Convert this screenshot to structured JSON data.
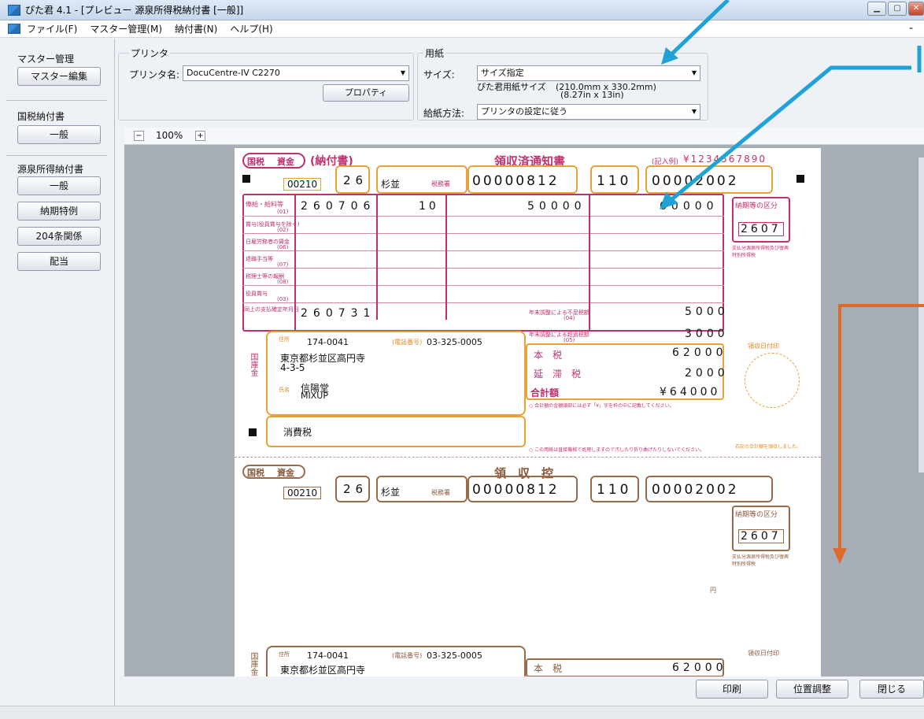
{
  "window": {
    "title": "ぴた君 4.1 - [プレビュー 源泉所得税納付書 [一般]]"
  },
  "menu": {
    "items": [
      "ファイル(F)",
      "マスター管理(M)",
      "納付書(N)",
      "ヘルプ(H)"
    ],
    "right": "-"
  },
  "sidebar": {
    "master_title": "マスター管理",
    "master_edit": "マスター編集",
    "national_title": "国税納付書",
    "national_general": "一般",
    "withholding_title": "源泉所得納付書",
    "withholding_items": [
      "一般",
      "納期特例",
      "204条関係",
      "配当"
    ]
  },
  "printer": {
    "legend": "プリンタ",
    "name_label": "プリンタ名:",
    "name_value": "DocuCentre-IV C2270",
    "properties_button": "プロパティ"
  },
  "paper": {
    "legend": "用紙",
    "size_label": "サイズ:",
    "size_value": "サイズ指定",
    "size_desc": "ぴた君用紙サイズ",
    "size_mm": "(210.0mm x 330.2mm)",
    "size_in": "(8.27in x 13in)",
    "feed_label": "給紙方法:",
    "feed_value": "プリンタの設定に従う"
  },
  "zoom": {
    "minus": "−",
    "value": "100%",
    "plus": "+"
  },
  "form": {
    "header_left": "国税",
    "header_kind": "資金",
    "header_notice": "(納付書)",
    "header_title": "領収済通知書",
    "header_example": "(記入例)",
    "example_digits": "¥1234567890",
    "office_code": "00210",
    "year": "26",
    "tax_office": "杉並",
    "tax_office_code": "税務署",
    "seiri": "00000812",
    "kamoku": "110",
    "number": "00002002",
    "kubun_title": "納期等の区分",
    "kubun_value": "2607",
    "kubun_note": "支払分源泉所得税及び復興特別所得税",
    "rows": [
      {
        "label": "俸給・給料等",
        "code": "(01)",
        "date": "260706",
        "people": "10",
        "amount": "50000",
        "tax": "60000"
      },
      {
        "label": "賞与(役員賞与を除く)",
        "code": "(02)"
      },
      {
        "label": "日雇労務者の賃金",
        "code": "(06)"
      },
      {
        "label": "退職手当等",
        "code": "(07)"
      },
      {
        "label": "税理士等の報酬",
        "code": "(08)"
      },
      {
        "label": "役員賞与",
        "code": "(03)"
      }
    ],
    "pay_date_label": "同上の支払確定年月日",
    "pay_date": "260731",
    "adj_short_label": "年末調整による不足税額",
    "adj_short_code": "(04)",
    "adj_short": "5000",
    "adj_over_label": "年末調整による超過税額",
    "adj_over_code": "(05)",
    "adj_over": "3000",
    "honzei_label": "本　税",
    "honzei": "62000",
    "entai_label": "延　滞　税",
    "entai": "2000",
    "total_label": "合計額",
    "total": "¥64000",
    "address_label": "住所",
    "postal": "174-0041",
    "phone_label": "(電話番号)",
    "phone": "03-325-0005",
    "address1": "東京都杉並区高円寺",
    "address2": "4-3-5",
    "name_label": "氏名",
    "name1": "信陽堂",
    "name2": "MIXUP",
    "biko": "消費税",
    "kokko": "国庫金",
    "total_note": "○ 合計額の金額頭部には必ず「¥」字を枠の中に記載してください。",
    "fold_note": "○ この用紙は直接機械で処理しますので汚したり折り曲げたりしないでください。",
    "receipt_stamp": "領収日付印",
    "receipt_confirm": "右記の合計額を領収しました。",
    "stub_title": "領　収　控",
    "stub_honzei": "62000",
    "en": "円"
  },
  "buttons": {
    "print": "印刷",
    "adjust": "位置調整",
    "close": "閉じる"
  },
  "colors": {
    "arrow_blue": "#1fa3d6",
    "arrow_orange": "#e0692c",
    "form_pink": "#c0306f",
    "form_orange": "#e8a23a",
    "form_brown": "#9a6b4b"
  }
}
